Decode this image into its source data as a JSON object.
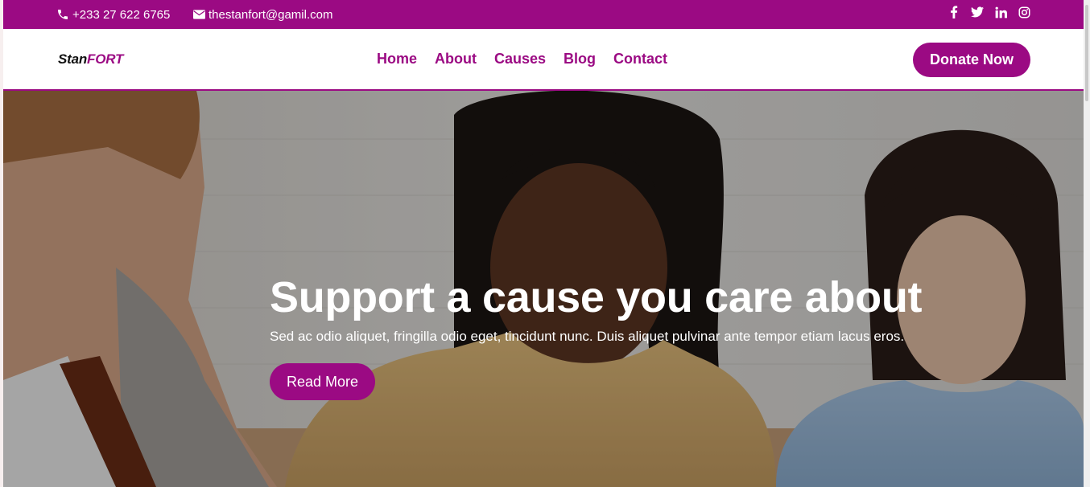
{
  "topbar": {
    "phone": "+233 27 622 6765",
    "email": "thestanfort@gamil.com",
    "socials": [
      {
        "icon": "facebook-icon"
      },
      {
        "icon": "twitter-icon"
      },
      {
        "icon": "linkedin-icon"
      },
      {
        "icon": "instagram-icon"
      }
    ]
  },
  "nav": {
    "logo_part1": "Stan",
    "logo_part2": "FORT",
    "items": [
      "Home",
      "About",
      "Causes",
      "Blog",
      "Contact"
    ],
    "cta": "Donate Now"
  },
  "hero": {
    "title": "Support a cause you care about",
    "subtitle": "Sed ac odio aliquet, fringilla odio eget, tincidunt nunc. Duis aliquet pulvinar ante tempor etiam lacus eros.",
    "button": "Read More"
  },
  "colors": {
    "brand": "#9b0a83",
    "white": "#ffffff"
  }
}
